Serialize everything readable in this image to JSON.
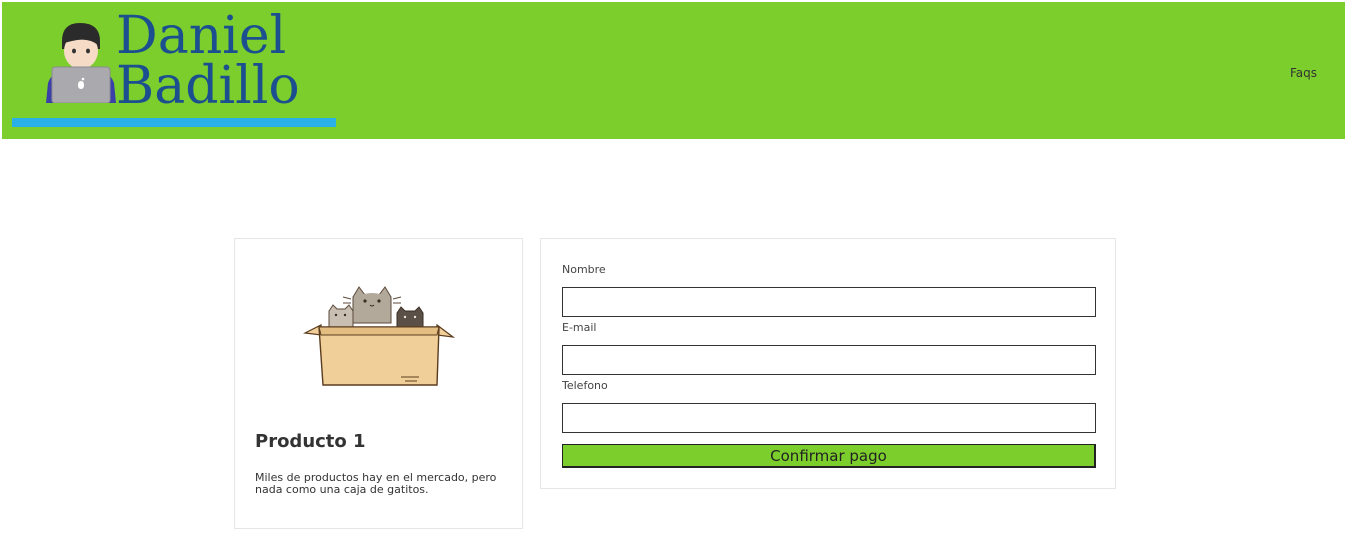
{
  "header": {
    "logo": {
      "line1": "Daniel",
      "line2": "Badillo",
      "avatar_icon": "person-with-laptop-icon"
    },
    "nav": {
      "faqs_label": "Faqs"
    },
    "colors": {
      "background": "#7bce2b",
      "logo_text": "#1c4f8f",
      "underline": "#2ab0e8"
    }
  },
  "product": {
    "image_icon": "cats-in-box-illustration",
    "title": "Producto 1",
    "description": "Miles de productos hay en el mercado, pero nada como una caja de gatitos."
  },
  "form": {
    "nombre_label": "Nombre",
    "nombre_value": "",
    "email_label": "E-mail",
    "email_value": "",
    "telefono_label": "Telefono",
    "telefono_value": "",
    "submit_label": "Confirmar pago",
    "submit_color": "#7bce2b"
  }
}
